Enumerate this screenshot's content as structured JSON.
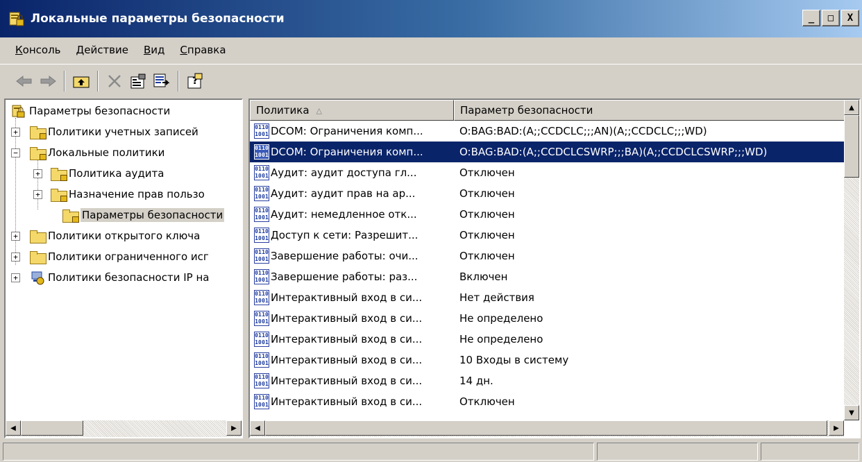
{
  "window": {
    "title": "Локальные параметры безопасности",
    "icon": "security-policy-icon",
    "buttons": {
      "minimize": "_",
      "maximize": "□",
      "close": "X"
    },
    "title_gradient": [
      "#0a246a",
      "#a6caf0"
    ]
  },
  "menu": {
    "items": [
      {
        "first": "К",
        "rest": "онсоль"
      },
      {
        "first": "Д",
        "rest": "ействие"
      },
      {
        "first": "В",
        "rest": "ид"
      },
      {
        "first": "С",
        "rest": "правка"
      }
    ]
  },
  "toolbar": {
    "buttons": [
      "back-arrow-icon",
      "forward-arrow-icon",
      "up-folder-icon",
      "delete-icon",
      "properties-icon",
      "export-list-icon",
      "help-icon"
    ]
  },
  "tree": {
    "items": [
      {
        "label": "Параметры безопасности",
        "icon": "security-root-icon"
      },
      {
        "label": "Политики учетных записей",
        "icon": "folder-lock-icon",
        "expander": "+"
      },
      {
        "label": "Локальные политики",
        "icon": "folder-lock-icon",
        "expander": "−"
      },
      {
        "label": "Политика аудита",
        "icon": "folder-lock-icon",
        "expander": "+"
      },
      {
        "label": "Назначение прав пользо",
        "icon": "folder-lock-icon",
        "expander": "+"
      },
      {
        "label": "Параметры безопасности",
        "icon": "folder-lock-icon",
        "selected": true
      },
      {
        "label": "Политики открытого ключа",
        "icon": "folder-icon",
        "expander": "+"
      },
      {
        "label": "Политики ограниченного исг",
        "icon": "folder-icon",
        "expander": "+"
      },
      {
        "label": "Политики безопасности IP на",
        "icon": "ip-security-icon",
        "expander": "+"
      }
    ]
  },
  "list": {
    "columns": [
      "Политика",
      "Параметр безопасности"
    ],
    "sort_indicator": "△",
    "rows": [
      {
        "policy": "DCOM: Ограничения комп...",
        "setting": "O:BAG:BAD:(A;;CCDCLC;;;AN)(A;;CCDCLC;;;WD)"
      },
      {
        "policy": "DCOM: Ограничения комп...",
        "setting": "O:BAG:BAD:(A;;CCDCLCSWRP;;;BA)(A;;CCDCLCSWRP;;;WD)",
        "selected": true
      },
      {
        "policy": "Аудит: аудит доступа гл...",
        "setting": "Отключен"
      },
      {
        "policy": "Аудит: аудит прав на ар...",
        "setting": "Отключен"
      },
      {
        "policy": "Аудит: немедленное отк...",
        "setting": "Отключен"
      },
      {
        "policy": "Доступ к сети: Разрешит...",
        "setting": "Отключен"
      },
      {
        "policy": "Завершение работы: очи...",
        "setting": "Отключен"
      },
      {
        "policy": "Завершение работы: раз...",
        "setting": "Включен"
      },
      {
        "policy": "Интерактивный вход в си...",
        "setting": "Нет действия"
      },
      {
        "policy": "Интерактивный вход в си...",
        "setting": "Не определено"
      },
      {
        "policy": "Интерактивный вход в си...",
        "setting": "Не определено"
      },
      {
        "policy": "Интерактивный вход в си...",
        "setting": "10 Входы в систему"
      },
      {
        "policy": "Интерактивный вход в си...",
        "setting": "14 дн."
      },
      {
        "policy": "Интерактивный вход в си...",
        "setting": "Отключен"
      }
    ]
  },
  "colors": {
    "selection": "#0a246a",
    "face": "#d4d0c8"
  }
}
